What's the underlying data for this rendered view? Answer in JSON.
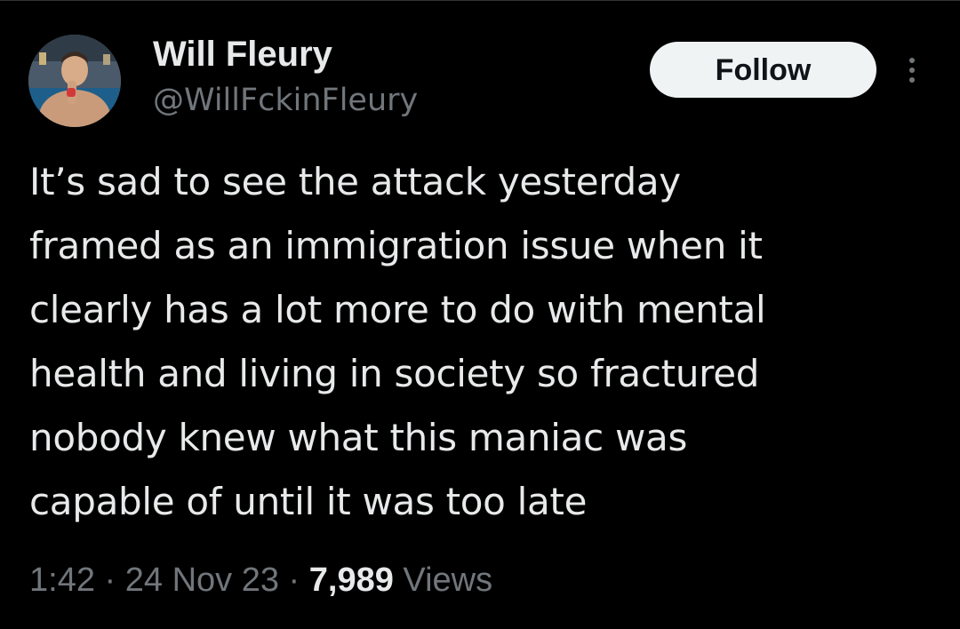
{
  "author": {
    "display_name": "Will Fleury",
    "handle": "@WillFckinFleury",
    "avatar_icon": "fighter-portrait-avatar"
  },
  "actions": {
    "follow_label": "Follow",
    "more_icon": "vertical-ellipsis-icon"
  },
  "tweet": {
    "lines": [
      "It’s sad to see the attack yesterday",
      "framed as an immigration issue when it",
      "clearly has a lot more to do with mental",
      "health and living in society so fractured",
      "nobody knew what this maniac was",
      "capable of until it was too late"
    ]
  },
  "meta": {
    "time": "1:42",
    "sep1": " · ",
    "date": "24 Nov 23",
    "sep2": " · ",
    "views_count": "7,989",
    "views_label": " Views"
  },
  "colors": {
    "background": "#000000",
    "text_primary": "#e7e9ea",
    "text_secondary": "#71767b",
    "button_bg": "#eff3f4",
    "button_text": "#0f1419"
  }
}
